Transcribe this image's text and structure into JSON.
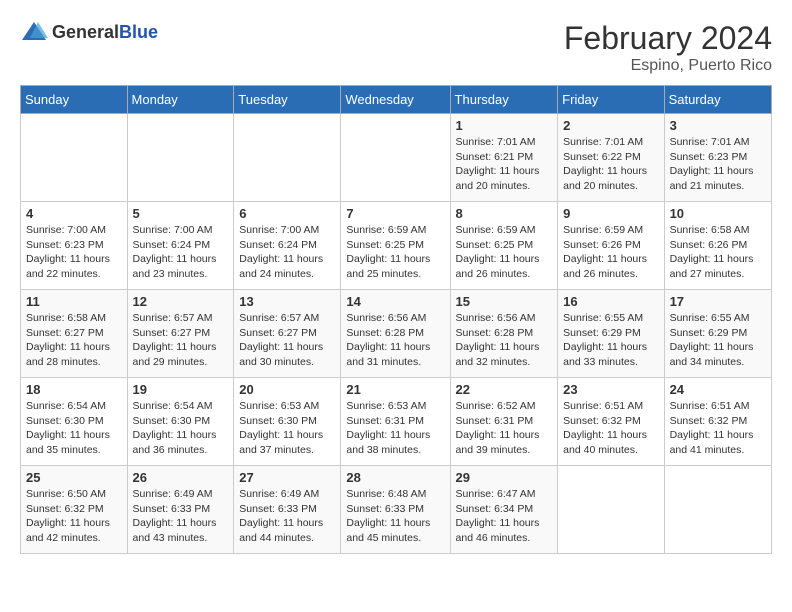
{
  "header": {
    "logo_general": "General",
    "logo_blue": "Blue",
    "month_year": "February 2024",
    "location": "Espino, Puerto Rico"
  },
  "weekdays": [
    "Sunday",
    "Monday",
    "Tuesday",
    "Wednesday",
    "Thursday",
    "Friday",
    "Saturday"
  ],
  "weeks": [
    [
      {
        "day": "",
        "sunrise": "",
        "sunset": "",
        "daylight": ""
      },
      {
        "day": "",
        "sunrise": "",
        "sunset": "",
        "daylight": ""
      },
      {
        "day": "",
        "sunrise": "",
        "sunset": "",
        "daylight": ""
      },
      {
        "day": "",
        "sunrise": "",
        "sunset": "",
        "daylight": ""
      },
      {
        "day": "1",
        "sunrise": "Sunrise: 7:01 AM",
        "sunset": "Sunset: 6:21 PM",
        "daylight": "Daylight: 11 hours and 20 minutes."
      },
      {
        "day": "2",
        "sunrise": "Sunrise: 7:01 AM",
        "sunset": "Sunset: 6:22 PM",
        "daylight": "Daylight: 11 hours and 20 minutes."
      },
      {
        "day": "3",
        "sunrise": "Sunrise: 7:01 AM",
        "sunset": "Sunset: 6:23 PM",
        "daylight": "Daylight: 11 hours and 21 minutes."
      }
    ],
    [
      {
        "day": "4",
        "sunrise": "Sunrise: 7:00 AM",
        "sunset": "Sunset: 6:23 PM",
        "daylight": "Daylight: 11 hours and 22 minutes."
      },
      {
        "day": "5",
        "sunrise": "Sunrise: 7:00 AM",
        "sunset": "Sunset: 6:24 PM",
        "daylight": "Daylight: 11 hours and 23 minutes."
      },
      {
        "day": "6",
        "sunrise": "Sunrise: 7:00 AM",
        "sunset": "Sunset: 6:24 PM",
        "daylight": "Daylight: 11 hours and 24 minutes."
      },
      {
        "day": "7",
        "sunrise": "Sunrise: 6:59 AM",
        "sunset": "Sunset: 6:25 PM",
        "daylight": "Daylight: 11 hours and 25 minutes."
      },
      {
        "day": "8",
        "sunrise": "Sunrise: 6:59 AM",
        "sunset": "Sunset: 6:25 PM",
        "daylight": "Daylight: 11 hours and 26 minutes."
      },
      {
        "day": "9",
        "sunrise": "Sunrise: 6:59 AM",
        "sunset": "Sunset: 6:26 PM",
        "daylight": "Daylight: 11 hours and 26 minutes."
      },
      {
        "day": "10",
        "sunrise": "Sunrise: 6:58 AM",
        "sunset": "Sunset: 6:26 PM",
        "daylight": "Daylight: 11 hours and 27 minutes."
      }
    ],
    [
      {
        "day": "11",
        "sunrise": "Sunrise: 6:58 AM",
        "sunset": "Sunset: 6:27 PM",
        "daylight": "Daylight: 11 hours and 28 minutes."
      },
      {
        "day": "12",
        "sunrise": "Sunrise: 6:57 AM",
        "sunset": "Sunset: 6:27 PM",
        "daylight": "Daylight: 11 hours and 29 minutes."
      },
      {
        "day": "13",
        "sunrise": "Sunrise: 6:57 AM",
        "sunset": "Sunset: 6:27 PM",
        "daylight": "Daylight: 11 hours and 30 minutes."
      },
      {
        "day": "14",
        "sunrise": "Sunrise: 6:56 AM",
        "sunset": "Sunset: 6:28 PM",
        "daylight": "Daylight: 11 hours and 31 minutes."
      },
      {
        "day": "15",
        "sunrise": "Sunrise: 6:56 AM",
        "sunset": "Sunset: 6:28 PM",
        "daylight": "Daylight: 11 hours and 32 minutes."
      },
      {
        "day": "16",
        "sunrise": "Sunrise: 6:55 AM",
        "sunset": "Sunset: 6:29 PM",
        "daylight": "Daylight: 11 hours and 33 minutes."
      },
      {
        "day": "17",
        "sunrise": "Sunrise: 6:55 AM",
        "sunset": "Sunset: 6:29 PM",
        "daylight": "Daylight: 11 hours and 34 minutes."
      }
    ],
    [
      {
        "day": "18",
        "sunrise": "Sunrise: 6:54 AM",
        "sunset": "Sunset: 6:30 PM",
        "daylight": "Daylight: 11 hours and 35 minutes."
      },
      {
        "day": "19",
        "sunrise": "Sunrise: 6:54 AM",
        "sunset": "Sunset: 6:30 PM",
        "daylight": "Daylight: 11 hours and 36 minutes."
      },
      {
        "day": "20",
        "sunrise": "Sunrise: 6:53 AM",
        "sunset": "Sunset: 6:30 PM",
        "daylight": "Daylight: 11 hours and 37 minutes."
      },
      {
        "day": "21",
        "sunrise": "Sunrise: 6:53 AM",
        "sunset": "Sunset: 6:31 PM",
        "daylight": "Daylight: 11 hours and 38 minutes."
      },
      {
        "day": "22",
        "sunrise": "Sunrise: 6:52 AM",
        "sunset": "Sunset: 6:31 PM",
        "daylight": "Daylight: 11 hours and 39 minutes."
      },
      {
        "day": "23",
        "sunrise": "Sunrise: 6:51 AM",
        "sunset": "Sunset: 6:32 PM",
        "daylight": "Daylight: 11 hours and 40 minutes."
      },
      {
        "day": "24",
        "sunrise": "Sunrise: 6:51 AM",
        "sunset": "Sunset: 6:32 PM",
        "daylight": "Daylight: 11 hours and 41 minutes."
      }
    ],
    [
      {
        "day": "25",
        "sunrise": "Sunrise: 6:50 AM",
        "sunset": "Sunset: 6:32 PM",
        "daylight": "Daylight: 11 hours and 42 minutes."
      },
      {
        "day": "26",
        "sunrise": "Sunrise: 6:49 AM",
        "sunset": "Sunset: 6:33 PM",
        "daylight": "Daylight: 11 hours and 43 minutes."
      },
      {
        "day": "27",
        "sunrise": "Sunrise: 6:49 AM",
        "sunset": "Sunset: 6:33 PM",
        "daylight": "Daylight: 11 hours and 44 minutes."
      },
      {
        "day": "28",
        "sunrise": "Sunrise: 6:48 AM",
        "sunset": "Sunset: 6:33 PM",
        "daylight": "Daylight: 11 hours and 45 minutes."
      },
      {
        "day": "29",
        "sunrise": "Sunrise: 6:47 AM",
        "sunset": "Sunset: 6:34 PM",
        "daylight": "Daylight: 11 hours and 46 minutes."
      },
      {
        "day": "",
        "sunrise": "",
        "sunset": "",
        "daylight": ""
      },
      {
        "day": "",
        "sunrise": "",
        "sunset": "",
        "daylight": ""
      }
    ]
  ]
}
